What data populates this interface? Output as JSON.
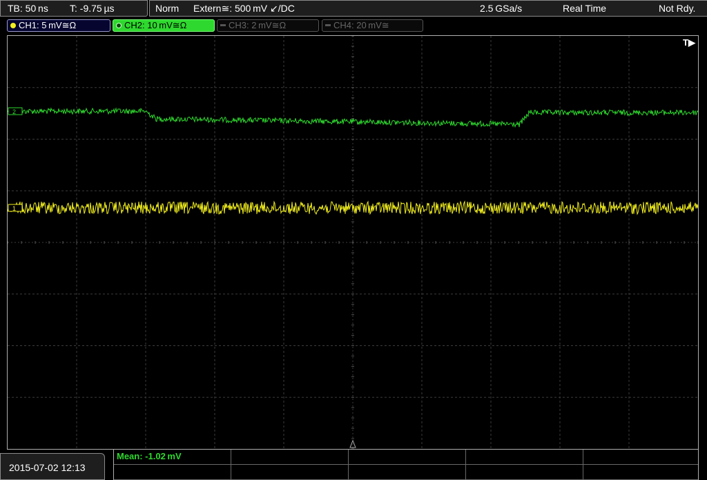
{
  "top_bar": {
    "timebase": "TB: 50 ns",
    "trigger_time": "T: -9.75 µs",
    "mode": "Norm",
    "trigger_source": "Extern≅: 500 mV ↙/DC",
    "sample_rate": "2.5 GSa/s",
    "acq_mode": "Real Time",
    "status": "Not Rdy."
  },
  "channels": [
    {
      "id": "ch1",
      "label": "CH1: 5 mV≅Ω",
      "color": "#f2ef1e",
      "active": true
    },
    {
      "id": "ch2",
      "label": "CH2: 10 mV≅Ω",
      "color": "#2ed82e",
      "active": true,
      "selected": true
    },
    {
      "id": "ch3",
      "label": "CH3: 2 mV≅Ω",
      "color": "#666666",
      "active": false
    },
    {
      "id": "ch4",
      "label": "CH4: 20 mV≅",
      "color": "#666666",
      "active": false
    }
  ],
  "screen": {
    "trigger_marker": "T▶",
    "ch2_marker_label": "2",
    "ch1_marker_label": "1"
  },
  "measurement": {
    "mean_label": "Mean: -1.02 mV"
  },
  "footer": {
    "datetime": "2015-07-02 12:13"
  },
  "colors": {
    "ch1_trace": "#f2ef1e",
    "ch2_trace": "#2ed82e",
    "grid": "#3c3c3c"
  }
}
